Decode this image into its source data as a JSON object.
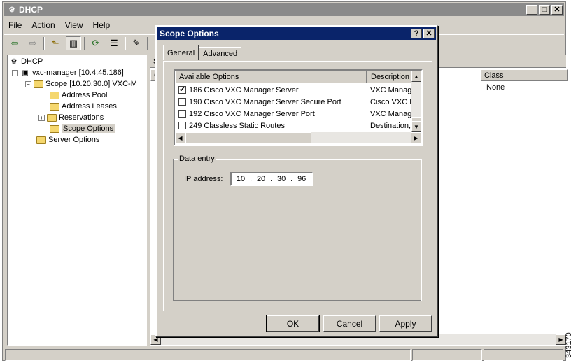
{
  "main_window": {
    "title": "DHCP",
    "controls": {
      "minimize": "_",
      "maximize": "□",
      "close": "✕"
    }
  },
  "menu": [
    {
      "label": "File",
      "underline": "F"
    },
    {
      "label": "Action",
      "underline": "A"
    },
    {
      "label": "View",
      "underline": "V"
    },
    {
      "label": "Help",
      "underline": "H"
    }
  ],
  "toolbar": {
    "icons": [
      "back-arrow-icon",
      "forward-arrow-icon",
      "up-folder-icon",
      "show-hide-tree-icon",
      "refresh-icon",
      "export-list-icon",
      "properties-icon",
      "help-icon"
    ],
    "glyphs": {
      "back": "⇦",
      "forward": "⇨",
      "up": "⬑",
      "tree": "▥",
      "refresh": "⟳",
      "export": "☰",
      "properties": "✎",
      "help": "?"
    }
  },
  "tree": {
    "root": "DHCP",
    "server": "vxc-manager [10.4.45.186]",
    "scope": "Scope [10.20.30.0] VXC-M",
    "items": [
      "Address Pool",
      "Address Leases",
      "Reservations",
      "Scope Options"
    ],
    "server_options": "Server Options",
    "selected": "Scope Options"
  },
  "right_pane": {
    "header_partial": "S",
    "col1_partial": "C",
    "class_header": "Class",
    "class_value": "None"
  },
  "dialog": {
    "title": "Scope Options",
    "help_btn": "?",
    "close_btn": "✕",
    "tabs": [
      "General",
      "Advanced"
    ],
    "active_tab": "General",
    "list": {
      "col_available": "Available Options",
      "col_description": "Description",
      "rows": [
        {
          "checked": true,
          "label": "186 Cisco VXC Manager Server",
          "description": "VXC Manag"
        },
        {
          "checked": false,
          "label": "190 Cisco VXC Manager Server Secure Port",
          "description": "Cisco VXC M"
        },
        {
          "checked": false,
          "label": "192 Cisco VXC Manager Server Port",
          "description": "VXC Manag"
        },
        {
          "checked": false,
          "label": "249 Classless Static Routes",
          "description": "Destination,"
        }
      ]
    },
    "data_entry": {
      "legend": "Data entry",
      "ip_label": "IP address:",
      "ip_octets": [
        "10",
        "20",
        "30",
        "96"
      ]
    },
    "buttons": {
      "ok": "OK",
      "cancel": "Cancel",
      "apply": "Apply"
    }
  },
  "side_caption": "343170",
  "colors": {
    "active_title": "#0a246a",
    "inactive_title": "#8a8a8a",
    "chrome": "#d4d0c8"
  }
}
